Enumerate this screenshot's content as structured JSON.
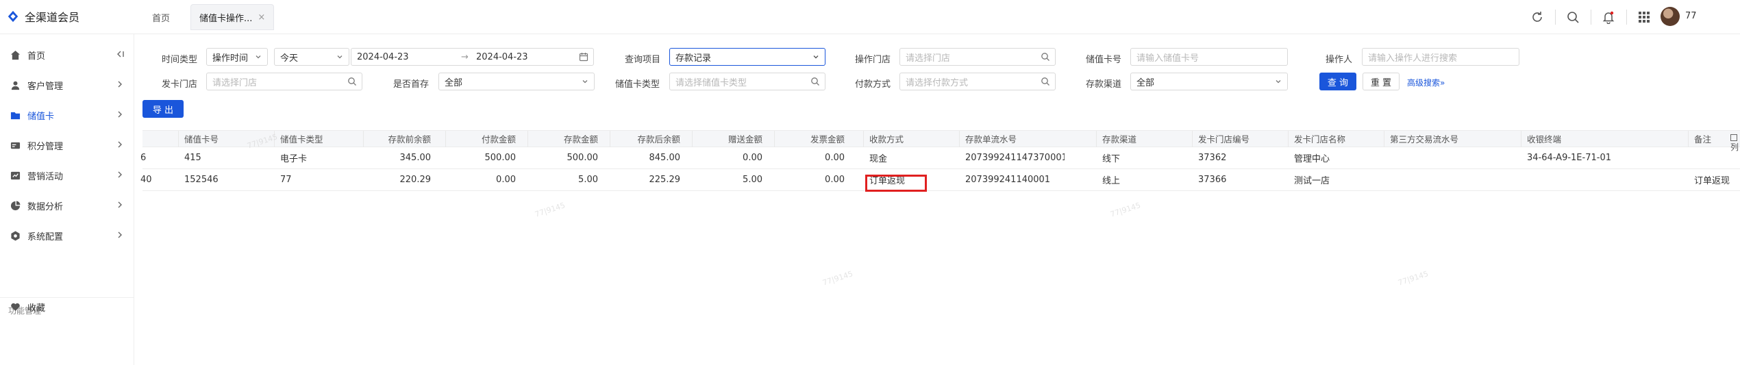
{
  "app": {
    "title": "全渠道会员",
    "user": "77"
  },
  "tabs": [
    {
      "label": "首页"
    },
    {
      "label": "储值卡操作..."
    }
  ],
  "sidebar": {
    "items": [
      {
        "label": "首页",
        "icon": "home-icon"
      },
      {
        "label": "客户管理",
        "icon": "user-icon"
      },
      {
        "label": "储值卡",
        "icon": "card-icon"
      },
      {
        "label": "积分管理",
        "icon": "points-icon"
      },
      {
        "label": "营销活动",
        "icon": "marketing-icon"
      },
      {
        "label": "数据分析",
        "icon": "pie-chart-icon"
      },
      {
        "label": "系统配置",
        "icon": "settings-icon"
      }
    ],
    "group_title": "功能管理",
    "favorites": {
      "label": "收藏",
      "icon": "heart-icon"
    }
  },
  "filters": {
    "time_type": {
      "label": "时间类型",
      "value": "操作时间"
    },
    "date_range": {
      "preset": "今天",
      "start": "2024-04-23",
      "separator": "→",
      "end": "2024-04-23"
    },
    "query_item": {
      "label": "查询项目",
      "value": "存款记录"
    },
    "store": {
      "label": "操作门店",
      "placeholder": "请选择门店"
    },
    "card_no": {
      "label": "储值卡号",
      "placeholder": "请输入储值卡号"
    },
    "operator": {
      "label": "操作人",
      "placeholder": "请输入操作人进行搜索"
    },
    "issue_store": {
      "label": "发卡门店",
      "placeholder": "请选择门店"
    },
    "first_deposit": {
      "label": "是否首存",
      "value": "全部"
    },
    "card_type": {
      "label": "储值卡类型",
      "placeholder": "请选择储值卡类型"
    },
    "pay_method": {
      "label": "付款方式",
      "placeholder": "请选择付款方式"
    },
    "channel": {
      "label": "存款渠道",
      "value": "全部"
    },
    "query_btn": "查 询",
    "reset_btn": "重 置",
    "advanced": "高级搜索"
  },
  "export_btn": "导 出",
  "table": {
    "columns": [
      "储值卡号",
      "储值卡类型",
      "存款前余额",
      "付款金额",
      "存款金额",
      "存款后余额",
      "赠送金额",
      "发票金额",
      "收款方式",
      "存款单流水号",
      "存款渠道",
      "发卡门店编号",
      "发卡门店名称",
      "第三方交易流水号",
      "收银终端",
      "备注"
    ],
    "rows": [
      {
        "lead": "6",
        "card_no": "415",
        "card_type": "电子卡",
        "before": "345.00",
        "paid": "500.00",
        "deposit": "500.00",
        "after": "845.00",
        "gift": "0.00",
        "invoice": "0.00",
        "pay_method": "现金",
        "serial": "2073992411473700​01",
        "channel": "线下",
        "store_no": "37362",
        "store_name": "管理中心",
        "third_party": "",
        "terminal": "34-64-A9-1E-71-01",
        "remark": ""
      },
      {
        "lead": "40",
        "card_no": "152546",
        "card_type": "77",
        "before": "220.29",
        "paid": "0.00",
        "deposit": "5.00",
        "after": "225.29",
        "gift": "5.00",
        "invoice": "0.00",
        "pay_method": "订单返现",
        "serial": "207399241140001",
        "channel": "线上",
        "store_no": "37366",
        "store_name": "测试一店",
        "third_party": "",
        "terminal": "",
        "remark": "订单返现"
      }
    ],
    "column_settings_label": "列"
  }
}
